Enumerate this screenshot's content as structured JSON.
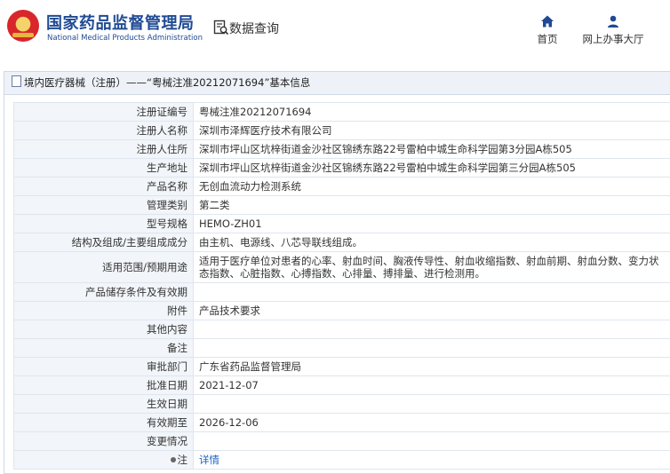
{
  "header": {
    "title_cn": "国家药品监督管理局",
    "title_en": "National Medical Products Administration",
    "query_label": "数据查询",
    "nav": {
      "home": "首页",
      "office": "网上办事大厅"
    }
  },
  "breadcrumb": "境内医疗器械（注册）——“粤械注准20212071694”基本信息",
  "rows": [
    {
      "label": "注册证编号",
      "value": "粤械注准20212071694"
    },
    {
      "label": "注册人名称",
      "value": "深圳市泽辉医疗技术有限公司"
    },
    {
      "label": "注册人住所",
      "value": "深圳市坪山区坑梓街道金沙社区锦绣东路22号雷柏中城生命科学园第3分园A栋505"
    },
    {
      "label": "生产地址",
      "value": "深圳市坪山区坑梓街道金沙社区锦绣东路22号雷柏中城生命科学园第三分园A栋505"
    },
    {
      "label": "产品名称",
      "value": "无创血流动力检测系统"
    },
    {
      "label": "管理类别",
      "value": "第二类"
    },
    {
      "label": "型号规格",
      "value": "HEMO-ZH01"
    },
    {
      "label": "结构及组成/主要组成成分",
      "value": "由主机、电源线、八芯导联线组成。"
    },
    {
      "label": "适用范围/预期用途",
      "value": "适用于医疗单位对患者的心率、射血时间、胸液传导性、射血收缩指数、射血前期、射血分数、变力状态指数、心脏指数、心搏指数、心排量、搏排量、进行检测用。"
    },
    {
      "label": "产品储存条件及有效期",
      "value": ""
    },
    {
      "label": "附件",
      "value": "产品技术要求"
    },
    {
      "label": "其他内容",
      "value": ""
    },
    {
      "label": "备注",
      "value": ""
    },
    {
      "label": "审批部门",
      "value": "广东省药品监督管理局"
    },
    {
      "label": "批准日期",
      "value": "2021-12-07"
    },
    {
      "label": "生效日期",
      "value": ""
    },
    {
      "label": "有效期至",
      "value": "2026-12-06"
    },
    {
      "label": "变更情况",
      "value": ""
    },
    {
      "label": "注",
      "value": "详情"
    }
  ]
}
